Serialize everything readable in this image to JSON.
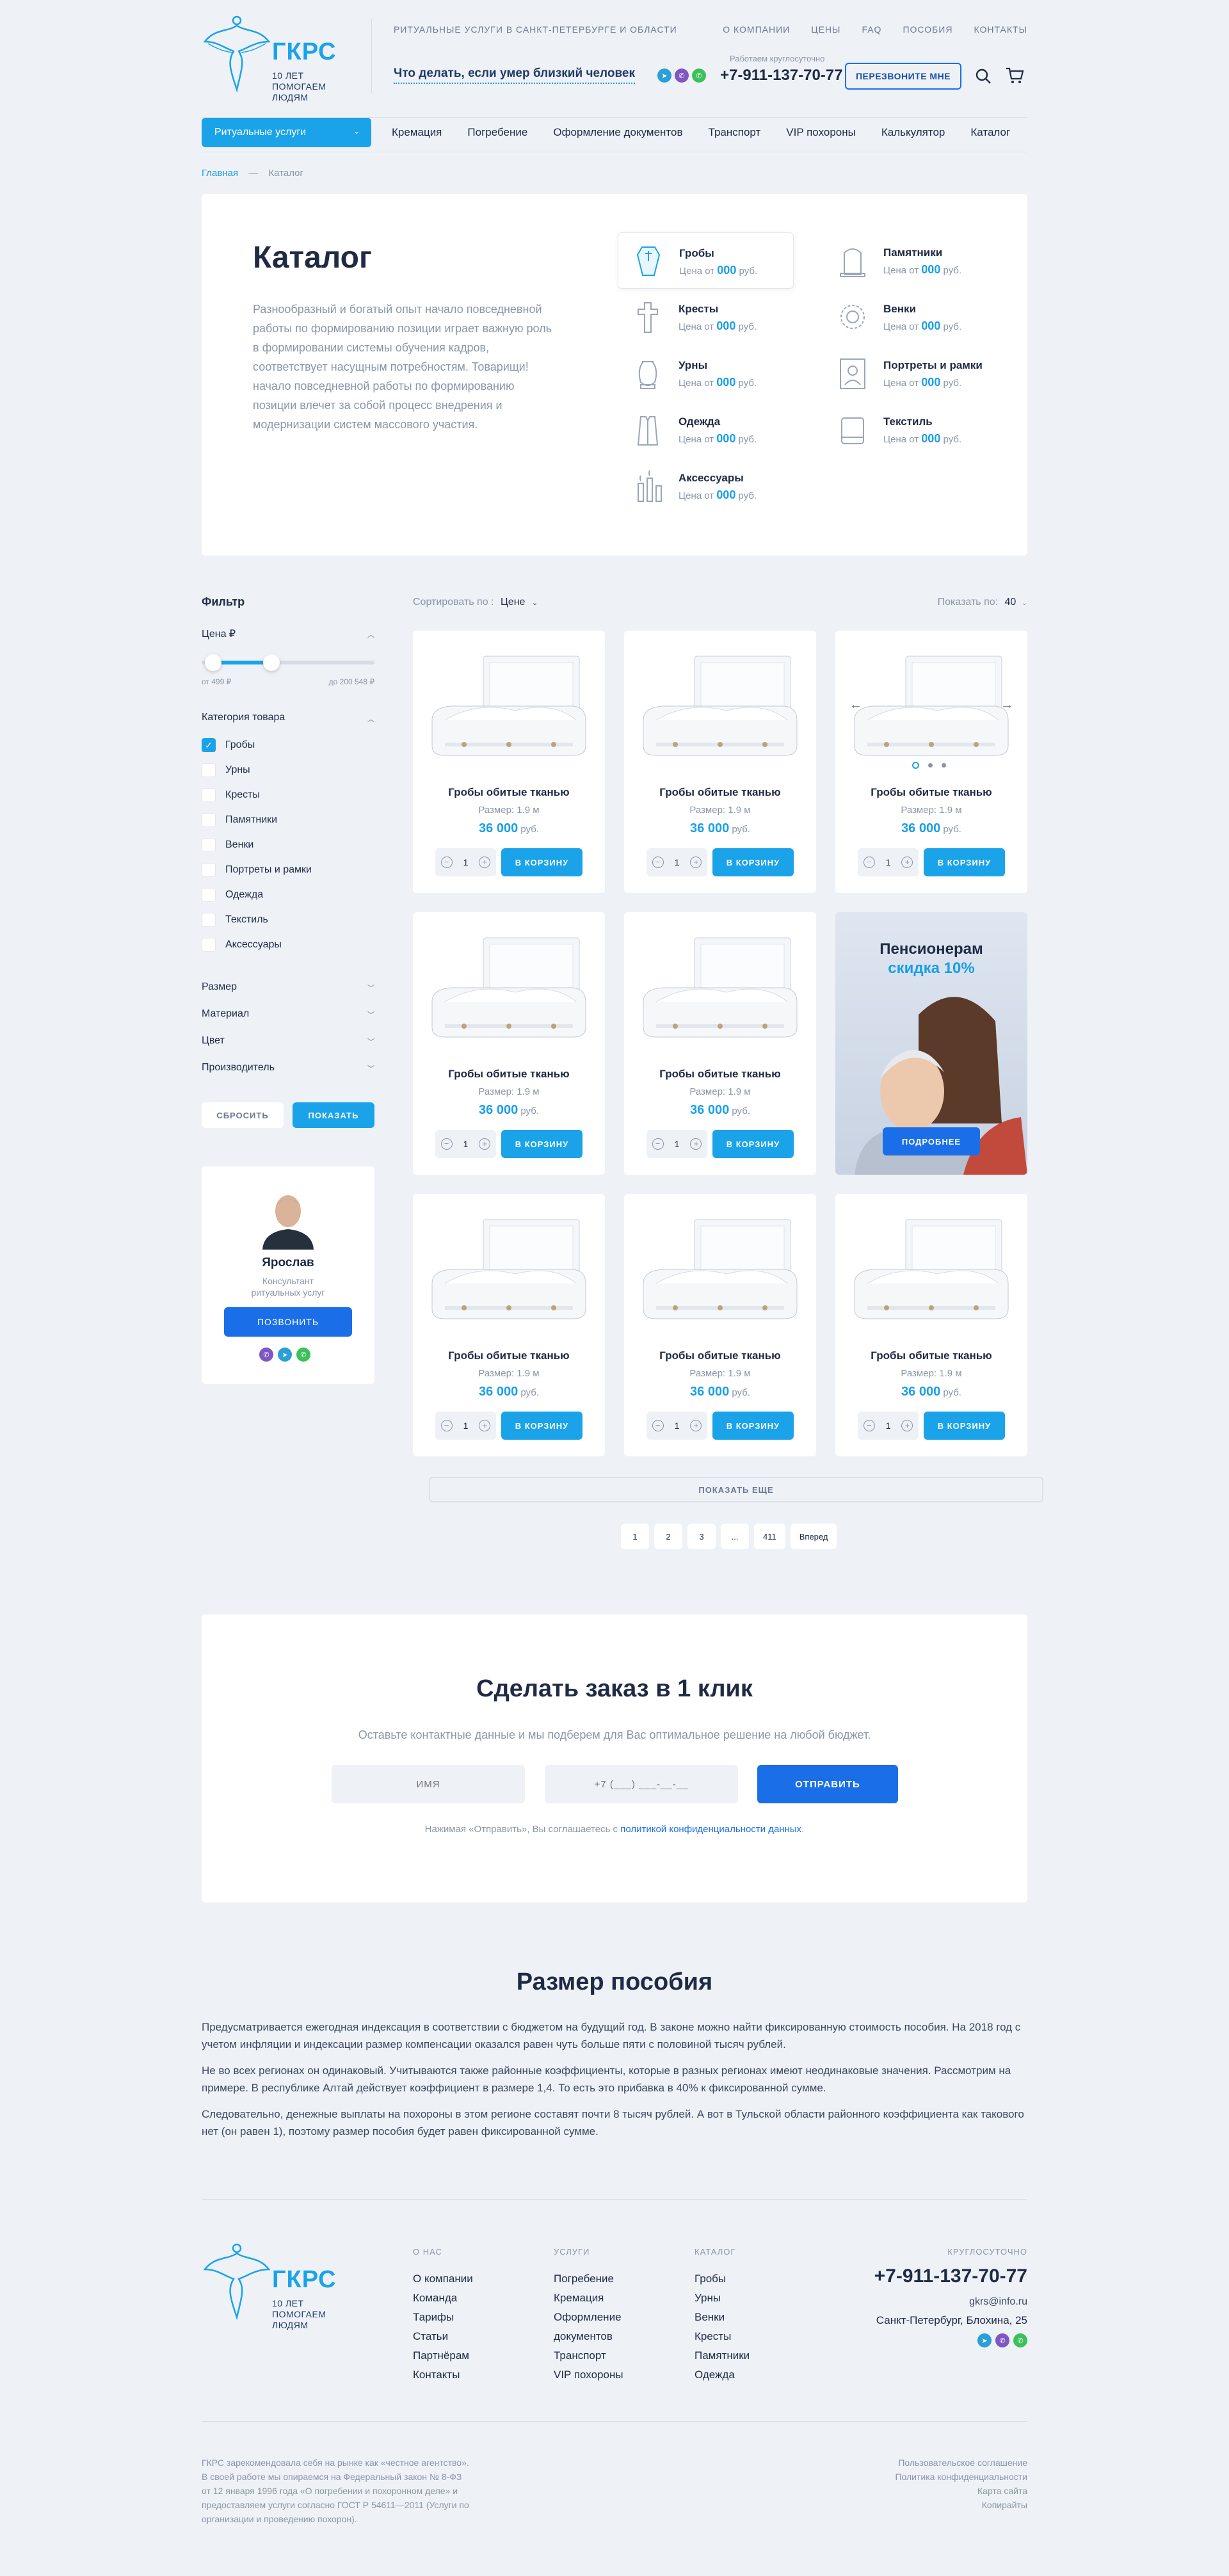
{
  "header": {
    "logo_name": "ГКРС",
    "logo_sub_line1": "10 ЛЕТ ПОМОГАЕМ",
    "logo_sub_line2": "ЛЮДЯМ",
    "tagline": "РИТУАЛЬНЫЕ УСЛУГИ В САНКТ-ПЕТЕРБУРГЕ И ОБЛАСТИ",
    "top_nav": [
      "О КОМПАНИИ",
      "ЦЕНЫ",
      "FAQ",
      "ПОСОБИЯ",
      "КОНТАКТЫ"
    ],
    "what_to_do": "Что делать, если умер близкий человек",
    "work_hours": "Работаем круглосуточно",
    "phone": "+7-911-137-70-77",
    "callback_label": "ПЕРЕЗВОНИТЕ МНЕ",
    "messenger_colors": [
      "#2a9fd8",
      "#7e57c2",
      "#3cc15a"
    ]
  },
  "menu": {
    "ritual_label": "Ритуальные услуги",
    "items": [
      "Кремация",
      "Погребение",
      "Оформление документов",
      "Транспорт",
      "VIP похороны",
      "Калькулятор",
      "Каталог"
    ]
  },
  "breadcrumb": {
    "home": "Главная",
    "sep": "—",
    "current": "Каталог"
  },
  "catalog": {
    "title": "Каталог",
    "description": "Разнообразный и богатый опыт начало повседневной работы по формированию позиции играет важную роль в формировании системы обучения кадров, соответствует насущным потребностям. Товарищи! начало повседневной работы по формированию позиции влечет за собой процесс внедрения и модернизации систем массового участия.",
    "price_prefix": "Цена от",
    "price_value": "000",
    "price_suffix": "руб.",
    "categories": [
      {
        "name": "Гробы",
        "icon": "coffin-icon"
      },
      {
        "name": "Памятники",
        "icon": "monument-icon"
      },
      {
        "name": "Кресты",
        "icon": "cross-icon"
      },
      {
        "name": "Венки",
        "icon": "wreath-icon"
      },
      {
        "name": "Урны",
        "icon": "urn-icon"
      },
      {
        "name": "Портреты и рамки",
        "icon": "portrait-icon"
      },
      {
        "name": "Одежда",
        "icon": "clothes-icon"
      },
      {
        "name": "Текстиль",
        "icon": "textile-icon"
      },
      {
        "name": "Аксессуары",
        "icon": "candles-icon"
      }
    ]
  },
  "filter": {
    "title": "Фильтр",
    "price_title": "Цена ₽",
    "price_min_label": "от 499 ₽",
    "price_max_label": "до 200 548 ₽",
    "category_title": "Категория товара",
    "category_options": [
      "Гробы",
      "Урны",
      "Кресты",
      "Памятники",
      "Венки",
      "Портреты и рамки",
      "Одежда",
      "Текстиль",
      "Аксессуары"
    ],
    "collapsed_sections": [
      "Размер",
      "Материал",
      "Цвет",
      "Производитель"
    ],
    "reset_label": "СБРОСИТЬ",
    "show_label": "ПОКАЗАТЬ"
  },
  "consultant": {
    "name": "Ярослав",
    "role_line1": "Консультант",
    "role_line2": "ритуальных услуг",
    "call_label": "ПОЗВОНИТЬ"
  },
  "listing": {
    "sort_label": "Сортировать по :",
    "sort_value": "Цене",
    "show_label": "Показать по:",
    "show_value": "40",
    "product": {
      "name": "Гробы обитые тканью",
      "size": "Размер: 1.9 м",
      "price": "36 000",
      "currency": "руб.",
      "qty": "1",
      "cart_label": "В КОРЗИНУ"
    },
    "promo": {
      "line1": "Пенсионерам",
      "line2": "скидка 10%",
      "button": "ПОДРОБНЕЕ"
    },
    "load_more": "ПОКАЗАТЬ ЕЩЕ",
    "pages": [
      "1",
      "2",
      "3",
      "...",
      "411",
      "Вперед"
    ]
  },
  "order": {
    "title": "Сделать заказ в 1 клик",
    "subtitle": "Оставьте контактные данные и мы подберем для Вас оптимальное решение на любой бюджет.",
    "name_placeholder": "ИМЯ",
    "phone_placeholder": "+7 (___) ___-__-__",
    "send_label": "ОТПРАВИТЬ",
    "note": "Нажимая «Отправить», Вы соглашаетесь с ",
    "note_link": "политикой конфиденциальности данных",
    "note_end": "."
  },
  "benefit": {
    "title": "Размер пособия",
    "p1": "Предусматривается ежегодная индексация в соответствии с бюджетом на будущий год. В законе можно найти фиксированную стоимость пособия. На 2018 год с учетом инфляции и индексации размер компенсации оказался равен чуть больше пяти с половиной тысяч рублей.",
    "p2": "Не во всех регионах он одинаковый. Учитываются также районные коэффициенты, которые в разных регионах имеют неодинаковые значения. Рассмотрим на примере. В республике Алтай действует коэффициент в размере 1,4. То есть это прибавка в 40% к фиксированной сумме.",
    "p3": "Следовательно, денежные выплаты на похороны в этом регионе составят почти 8 тысяч рублей. А вот в Тульской области районного коэффициента как такового нет (он равен 1), поэтому размер пособия будет равен фиксированной сумме."
  },
  "footer": {
    "about_title": "О НАС",
    "about_links": [
      "О компании",
      "Команда",
      "Тарифы",
      "Статьи",
      "Партнёрам",
      "Контакты"
    ],
    "services_title": "УСЛУГИ",
    "services_links": [
      "Погребение",
      "Кремация",
      "Оформление",
      "документов",
      "Транспорт",
      "VIP похороны"
    ],
    "catalog_title": "КАТАЛОГ",
    "catalog_links": [
      "Гробы",
      "Урны",
      "Венки",
      "Кресты",
      "Памятники",
      "Одежда"
    ],
    "roundclock": "КРУГЛОСУТОЧНО",
    "phone": "+7-911-137-70-77",
    "email": "gkrs@info.ru",
    "address": "Санкт-Петербург, Блохина, 25",
    "about_text": "ГКРС зарекомендовала себя на рынке как «честное агентство». В своей работе мы опираемся на Федеральный закон № 8-ФЗ от 12 января 1996 года «О погребении и похоронном деле» и предоставляем услуги согласно ГОСТ Р 54611—2011 (Услуги по организации и проведению похорон).",
    "legal_links": [
      "Пользовательское соглашение",
      "Политика конфиденциальности",
      "Карта сайта",
      "Копирайты"
    ]
  }
}
